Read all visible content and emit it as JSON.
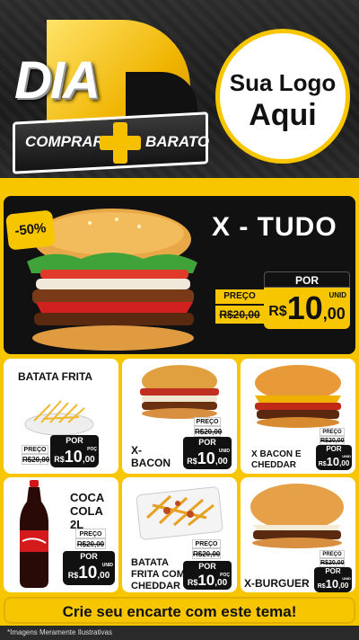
{
  "header": {
    "dia": "DIA",
    "ribbon_left": "COMPRAR",
    "ribbon_right": "BARATO",
    "logo_line1": "Sua Logo",
    "logo_line2": "Aqui"
  },
  "hero": {
    "discount": "-50%",
    "name": "X - TUDO",
    "preco_label": "PREÇO",
    "old_price": "R$20,00",
    "por_label": "POR",
    "currency": "R$",
    "price_int": "10",
    "price_dec": ",00",
    "unit": "UNID"
  },
  "products": [
    {
      "name": "BATATA FRITA",
      "preco_label": "PREÇO",
      "old_price": "R$20,00",
      "por_label": "POR",
      "currency": "R$",
      "price_int": "10",
      "price_dec": ",00",
      "unit": "POÇ"
    },
    {
      "name": "X-\nBACON",
      "preco_label": "PREÇO",
      "old_price": "R$20,00",
      "por_label": "POR",
      "currency": "R$",
      "price_int": "10",
      "price_dec": ",00",
      "unit": "UNID"
    },
    {
      "name": "X BACON E CHEDDAR",
      "preco_label": "PREÇO",
      "old_price": "R$20,00",
      "por_label": "POR",
      "currency": "R$",
      "price_int": "10",
      "price_dec": ",00",
      "unit": "UNID"
    },
    {
      "name": "COCA COLA 2L",
      "preco_label": "PREÇO",
      "old_price": "R$20,00",
      "por_label": "POR",
      "currency": "R$",
      "price_int": "10",
      "price_dec": ",00",
      "unit": "UNID"
    },
    {
      "name": "BATATA FRITA COM CHEDDAR",
      "preco_label": "PREÇO",
      "old_price": "R$20,00",
      "por_label": "POR",
      "currency": "R$",
      "price_int": "10",
      "price_dec": ",00",
      "unit": "POÇ"
    },
    {
      "name": "X-BURGUER",
      "preco_label": "PREÇO",
      "old_price": "R$20,00",
      "por_label": "POR",
      "currency": "R$",
      "price_int": "10",
      "price_dec": ",00",
      "unit": "UNID"
    }
  ],
  "footer": {
    "cta": "Crie seu encarte com este tema!",
    "disclaimer": "*Imagens Meramente Ilustrativas"
  },
  "colors": {
    "accent": "#f7c600",
    "dark": "#111111",
    "red": "#d32020"
  }
}
